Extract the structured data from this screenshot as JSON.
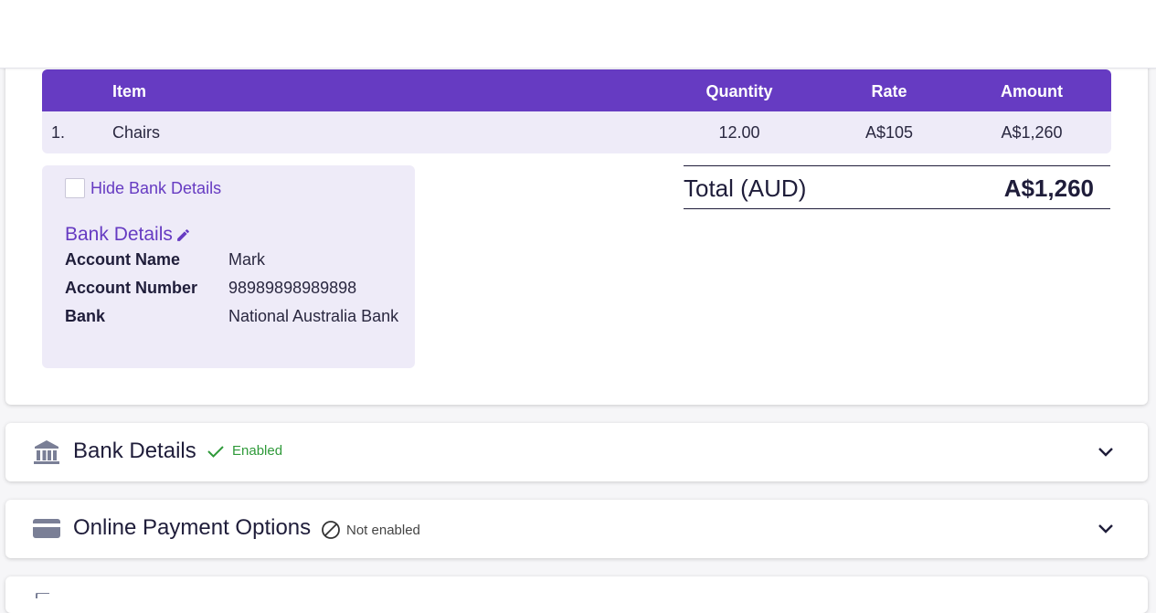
{
  "table": {
    "headers": {
      "item": "Item",
      "quantity": "Quantity",
      "rate": "Rate",
      "amount": "Amount"
    },
    "rows": [
      {
        "num": "1.",
        "item": "Chairs",
        "quantity": "12.00",
        "rate": "A$105",
        "amount": "A$1,260"
      }
    ]
  },
  "bank_box": {
    "hide_label": "Hide Bank Details",
    "title": "Bank Details",
    "fields": [
      {
        "label": "Account Name",
        "value": "Mark"
      },
      {
        "label": "Account Number",
        "value": "98989898989898"
      },
      {
        "label": "Bank",
        "value": "National Australia Bank"
      }
    ]
  },
  "total": {
    "label": "Total (AUD)",
    "value": "A$1,260"
  },
  "sections": [
    {
      "title": "Bank Details",
      "status": "Enabled",
      "icon": "bank-icon"
    },
    {
      "title": "Online Payment Options",
      "status": "Not enabled",
      "icon": "credit-card-icon"
    }
  ],
  "colors": {
    "accent": "#663bc2",
    "light": "#eeebf8",
    "success": "#2f9a3a"
  }
}
